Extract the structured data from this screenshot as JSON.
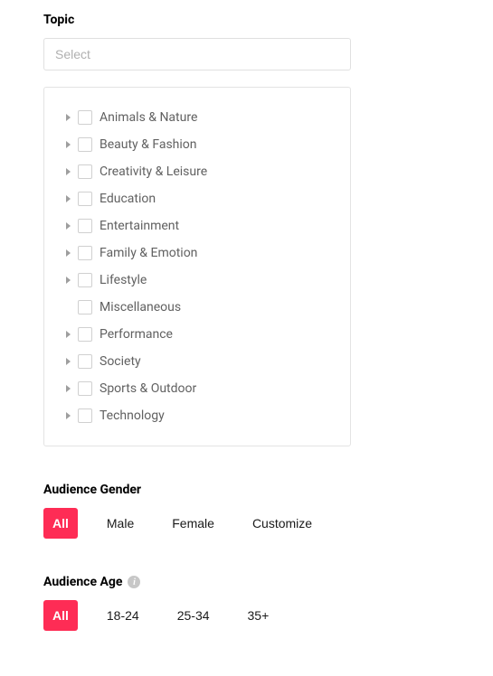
{
  "topic": {
    "title": "Topic",
    "placeholder": "Select",
    "items": [
      {
        "label": "Animals & Nature",
        "expandable": true
      },
      {
        "label": "Beauty & Fashion",
        "expandable": true
      },
      {
        "label": "Creativity & Leisure",
        "expandable": true
      },
      {
        "label": "Education",
        "expandable": true
      },
      {
        "label": "Entertainment",
        "expandable": true
      },
      {
        "label": "Family & Emotion",
        "expandable": true
      },
      {
        "label": "Lifestyle",
        "expandable": true
      },
      {
        "label": "Miscellaneous",
        "expandable": false
      },
      {
        "label": "Performance",
        "expandable": true
      },
      {
        "label": "Society",
        "expandable": true
      },
      {
        "label": "Sports & Outdoor",
        "expandable": true
      },
      {
        "label": "Technology",
        "expandable": true
      }
    ]
  },
  "gender": {
    "title": "Audience Gender",
    "options": [
      {
        "label": "All",
        "active": true
      },
      {
        "label": "Male",
        "active": false
      },
      {
        "label": "Female",
        "active": false
      },
      {
        "label": "Customize",
        "active": false
      }
    ]
  },
  "age": {
    "title": "Audience Age",
    "info_glyph": "i",
    "options": [
      {
        "label": "All",
        "active": true
      },
      {
        "label": "18-24",
        "active": false
      },
      {
        "label": "25-34",
        "active": false
      },
      {
        "label": "35+",
        "active": false
      }
    ]
  },
  "colors": {
    "accent": "#fe2c55"
  }
}
